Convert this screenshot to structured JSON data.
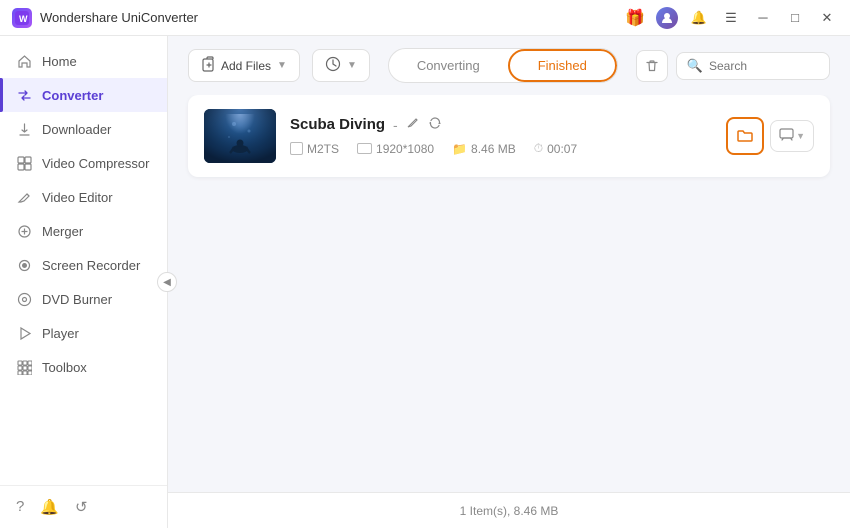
{
  "app": {
    "name": "Wondershare UniConverter",
    "icon_text": "W"
  },
  "titlebar": {
    "gift_icon": "🎁",
    "menu_icon": "☰",
    "minimize_icon": "─",
    "maximize_icon": "□",
    "close_icon": "✕"
  },
  "sidebar": {
    "items": [
      {
        "id": "home",
        "label": "Home",
        "icon": "🏠"
      },
      {
        "id": "converter",
        "label": "Converter",
        "icon": "⇄",
        "active": true
      },
      {
        "id": "downloader",
        "label": "Downloader",
        "icon": "⬇"
      },
      {
        "id": "video-compressor",
        "label": "Video Compressor",
        "icon": "🗜"
      },
      {
        "id": "video-editor",
        "label": "Video Editor",
        "icon": "✂"
      },
      {
        "id": "merger",
        "label": "Merger",
        "icon": "⊕"
      },
      {
        "id": "screen-recorder",
        "label": "Screen Recorder",
        "icon": "⏺"
      },
      {
        "id": "dvd-burner",
        "label": "DVD Burner",
        "icon": "💿"
      },
      {
        "id": "player",
        "label": "Player",
        "icon": "▶"
      },
      {
        "id": "toolbox",
        "label": "Toolbox",
        "icon": "⚙"
      }
    ],
    "bottom_icons": [
      "?",
      "🔔",
      "↺"
    ]
  },
  "toolbar": {
    "add_file_label": "Add Files",
    "add_icon": "+",
    "convert_icon": "⊕",
    "collapse_icon": "◀"
  },
  "tabs": {
    "converting_label": "Converting",
    "finished_label": "Finished",
    "active": "finished"
  },
  "search": {
    "placeholder": "Search",
    "icon": "🔍"
  },
  "file": {
    "name": "Scuba Diving",
    "dash": "-",
    "format": "M2TS",
    "resolution": "1920*1080",
    "size": "8.46 MB",
    "duration": "00:07"
  },
  "statusbar": {
    "text": "1 Item(s), 8.46 MB"
  }
}
